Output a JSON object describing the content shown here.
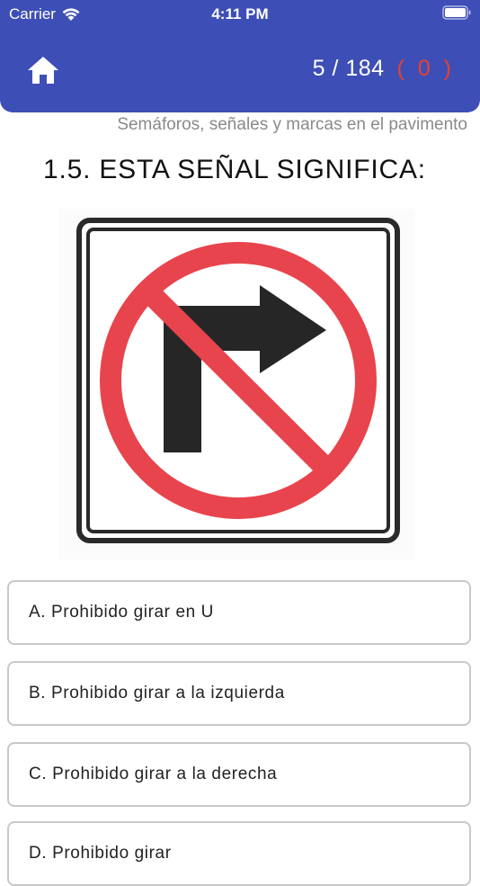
{
  "status_bar": {
    "carrier": "Carrier",
    "time": "4:11 PM"
  },
  "header": {
    "progress": "5 / 184",
    "wrong_count": "( 0 )",
    "colors": {
      "background": "#3d4fb6",
      "wrong": "#e8402e"
    }
  },
  "question": {
    "category": "Semáforos, señales y marcas en el pavimento",
    "text": "1.5. ESTA SEÑAL SIGNIFICA:",
    "image_icon": "no-right-turn-sign"
  },
  "options": [
    {
      "label": "A. Prohibido girar en U"
    },
    {
      "label": "B. Prohibido girar a la izquierda"
    },
    {
      "label": "C. Prohibido girar a la derecha"
    },
    {
      "label": "D. Prohibido girar"
    }
  ]
}
